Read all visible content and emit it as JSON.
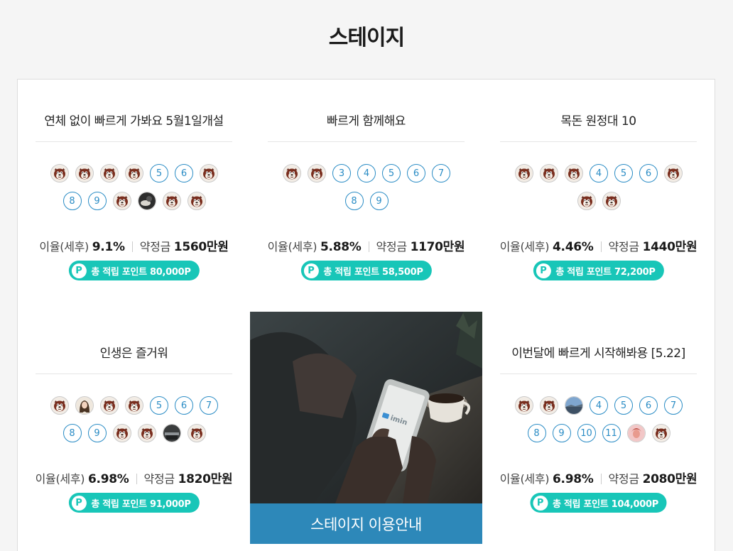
{
  "page": {
    "title": "스테이지"
  },
  "labels": {
    "rate_prefix": "이율(세후)",
    "deposit_prefix": "약정금",
    "point_badge": "P"
  },
  "colors": {
    "accent_teal": "#18c6b8",
    "slot_blue": "#2a8cc5",
    "guide_blue": "#2d88b9"
  },
  "stages": [
    {
      "title": "연체 없이 빠르게 가봐요 5월1일개설",
      "slots": [
        "avatar",
        "avatar",
        "avatar",
        "avatar",
        "5",
        "6",
        "avatar",
        "8",
        "9",
        "avatar",
        "photo-dark",
        "avatar",
        "avatar"
      ],
      "rate": "9.1%",
      "deposit": "1560만원",
      "points": "총 적립 포인트 80,000P"
    },
    {
      "title": "빠르게 함께해요",
      "slots": [
        "avatar",
        "avatar",
        "3",
        "4",
        "5",
        "6",
        "7",
        "8",
        "9"
      ],
      "rate": "5.88%",
      "deposit": "1170만원",
      "points": "총 적립 포인트 58,500P"
    },
    {
      "title": "목돈 원정대 10",
      "slots": [
        "avatar",
        "avatar",
        "avatar",
        "4",
        "5",
        "6",
        "avatar",
        "avatar",
        "avatar"
      ],
      "rate": "4.46%",
      "deposit": "1440만원",
      "points": "총 적립 포인트 72,200P"
    },
    {
      "title": "인생은 즐거워",
      "slots": [
        "avatar",
        "photo-woman",
        "avatar",
        "avatar",
        "5",
        "6",
        "7",
        "8",
        "9",
        "avatar",
        "avatar",
        "photo-dark2",
        "avatar"
      ],
      "rate": "6.98%",
      "deposit": "1820만원",
      "points": "총 적립 포인트 91,000P"
    },
    {
      "title": "이번달에 빠르게 시작해봐용 [5.22]",
      "slots": [
        "avatar",
        "avatar",
        "photo-sky",
        "4",
        "5",
        "6",
        "7",
        "8",
        "9",
        "10",
        "11",
        "photo-pink",
        "avatar"
      ],
      "rate": "6.98%",
      "deposit": "2080만원",
      "points": "총 적립 포인트 104,000P"
    }
  ],
  "guide": {
    "banner_label": "스테이지 이용안내",
    "phone_logo": "imin"
  }
}
